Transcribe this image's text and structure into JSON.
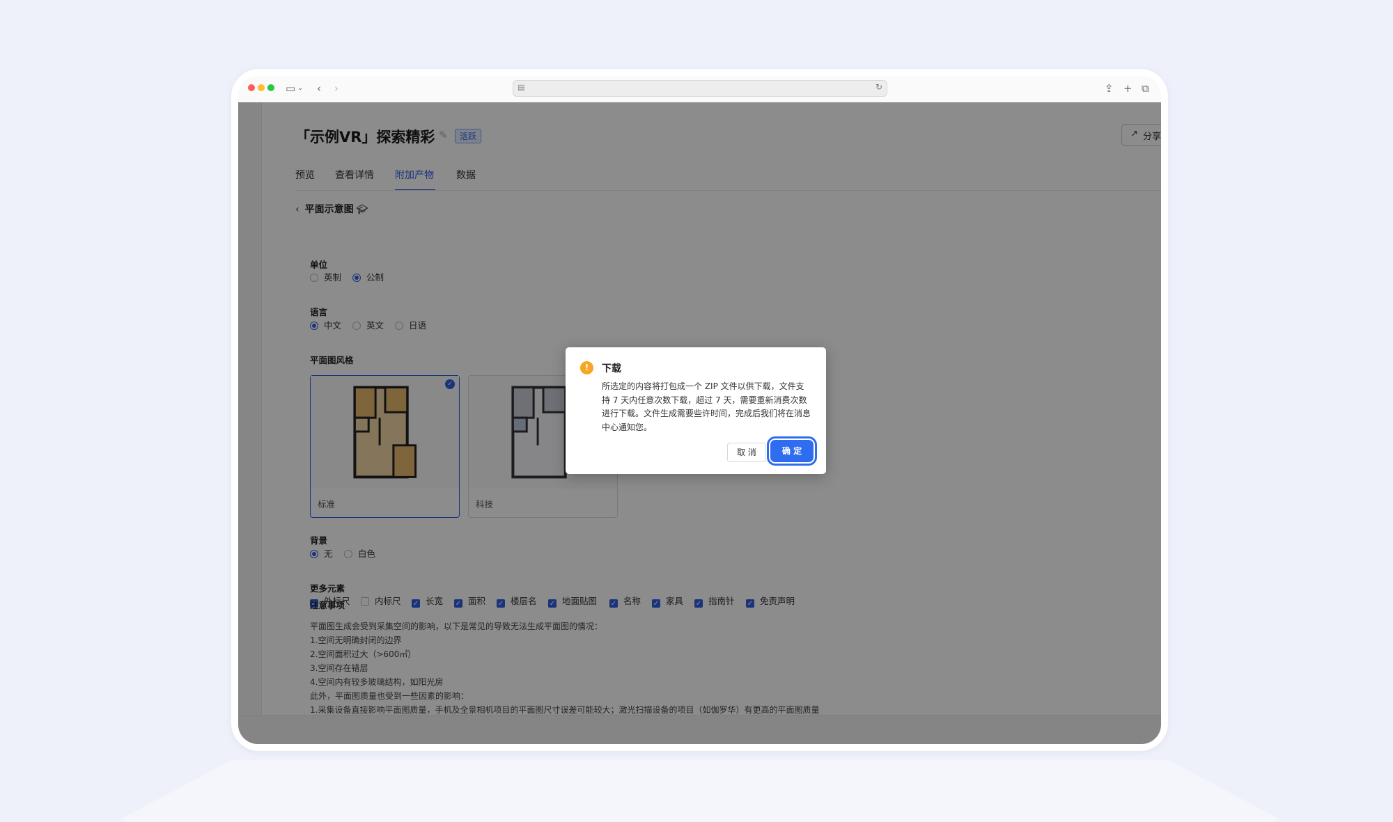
{
  "page": {
    "title": "「示例VR」探索精彩",
    "status_badge": "活跃",
    "share_label": "分享"
  },
  "tabs": [
    {
      "label": "预览"
    },
    {
      "label": "查看详情"
    },
    {
      "label": "附加产物",
      "active": true
    },
    {
      "label": "数据"
    }
  ],
  "section": {
    "back_title": "平面示意图"
  },
  "unit": {
    "label": "单位",
    "options": [
      {
        "label": "英制",
        "selected": false
      },
      {
        "label": "公制",
        "selected": true
      }
    ]
  },
  "language": {
    "label": "语言",
    "options": [
      {
        "label": "中文",
        "selected": true
      },
      {
        "label": "英文",
        "selected": false
      },
      {
        "label": "日语",
        "selected": false
      }
    ]
  },
  "plan_style": {
    "label": "平面图风格",
    "options": [
      {
        "label": "标准",
        "selected": true
      },
      {
        "label": "科技",
        "selected": false
      }
    ]
  },
  "background": {
    "label": "背景",
    "options": [
      {
        "label": "无",
        "selected": true
      },
      {
        "label": "白色",
        "selected": false
      }
    ]
  },
  "more_elements": {
    "label": "更多元素",
    "options": [
      {
        "label": "外标尺",
        "checked": true
      },
      {
        "label": "内标尺",
        "checked": false
      },
      {
        "label": "长宽",
        "checked": true
      },
      {
        "label": "面积",
        "checked": true
      },
      {
        "label": "楼层名",
        "checked": true
      },
      {
        "label": "地面贴图",
        "checked": true
      },
      {
        "label": "名称",
        "checked": true
      },
      {
        "label": "家具",
        "checked": true
      },
      {
        "label": "指南针",
        "checked": true
      },
      {
        "label": "免责声明",
        "checked": true
      }
    ]
  },
  "notes": {
    "label": "注意事项",
    "lines": [
      "平面图生成会受到采集空间的影响，以下是常见的导致无法生成平面图的情况：",
      "1.空间无明确封闭的边界",
      "2.空间面积过大（>600㎡）",
      "3.空间存在错层",
      "4.空间内有较多玻璃结构，如阳光房",
      "此外，平面图质量也受到一些因素的影响：",
      "1.采集设备直接影响平面图质量，手机及全景相机项目的平面图尺寸误差可能较大；激光扫描设备的项目（如伽罗华）有更高的平面图质量"
    ]
  },
  "dialog": {
    "title": "下载",
    "body": "所选定的内容将打包成一个 ZIP 文件以供下载，文件支持 7 天内任意次数下载，超过 7 天，需要重新消费次数进行下载。文件生成需要些许时间，完成后我们将在消息中心通知您。",
    "cancel_label": "取 消",
    "ok_label": "确 定"
  },
  "colors": {
    "accent": "#2f5fe0",
    "warning": "#f5a623"
  }
}
